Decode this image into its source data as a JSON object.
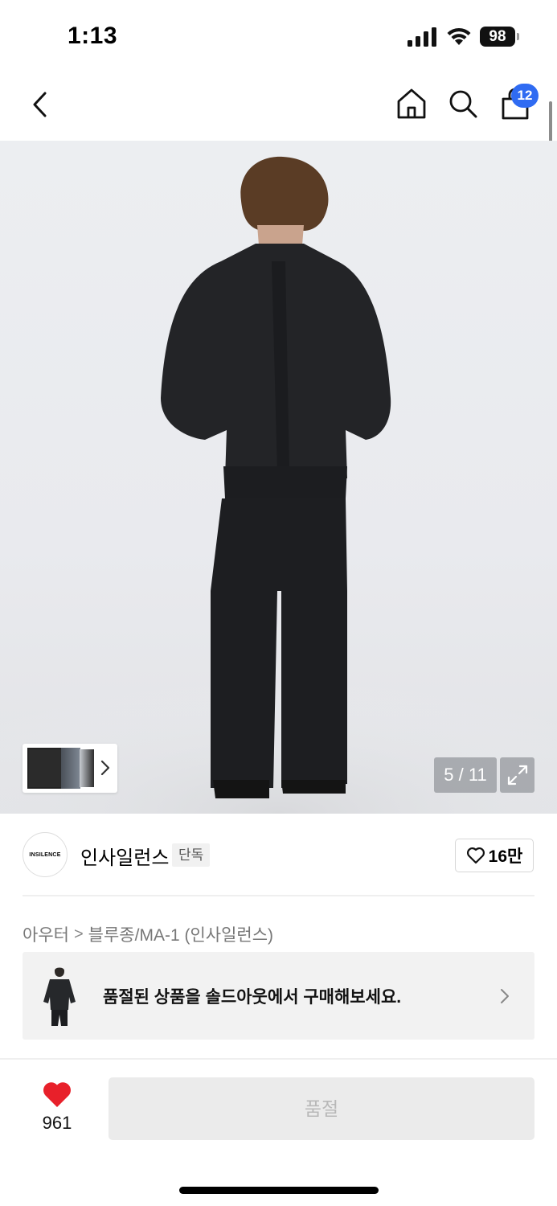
{
  "status_bar": {
    "time": "1:13",
    "battery": "98",
    "icons": [
      "cellular-signal-icon",
      "wifi-icon",
      "battery-icon"
    ]
  },
  "nav": {
    "icons": [
      "back-arrow-icon",
      "home-icon",
      "search-icon",
      "shopping-bag-icon"
    ],
    "cart_count": "12"
  },
  "gallery": {
    "counter": "5 / 11",
    "thumbnail_icons": [
      "chevron-right-icon"
    ],
    "expand_icon": "expand-icon"
  },
  "brand": {
    "logo_text": "INSILENCE",
    "name": "인사일런스",
    "tag": "단독",
    "like_count": "16만"
  },
  "breadcrumb": {
    "category": "아우터",
    "separator": ">",
    "subcategory": "블루종/MA-1 (인사일런스)"
  },
  "soldout_banner": {
    "text": "품절된 상품을 솔드아웃에서 구매해보세요."
  },
  "bottom_bar": {
    "wish_count": "961",
    "buy_button_label": "품절"
  },
  "colors": {
    "badge_blue": "#2f6bf2",
    "heart_red": "#e8202a",
    "disabled_bg": "#ebebeb",
    "disabled_text": "#b8b8b8"
  }
}
